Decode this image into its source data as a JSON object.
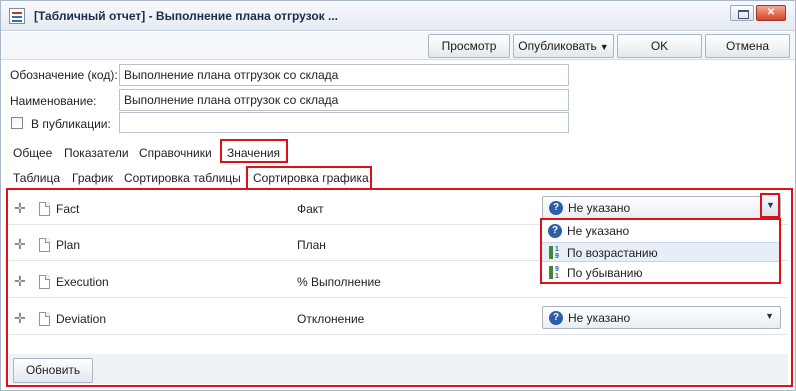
{
  "window": {
    "title": "[Табличный отчет] - Выполнение плана отгрузок ..."
  },
  "toolbar": {
    "preview_label": "Просмотр",
    "publish_label": "Опубликовать",
    "ok_label": "OK",
    "cancel_label": "Отмена"
  },
  "form": {
    "code_label": "Обозначение (код):",
    "code_value": "Выполнение плана отгрузок со склада",
    "name_label": "Наименование:",
    "name_value": "Выполнение плана отгрузок со склада",
    "publish_label": "В публикации:",
    "publish_value": ""
  },
  "tabs": [
    "Общее",
    "Показатели",
    "Справочники",
    "Значения"
  ],
  "subtabs": [
    "Таблица",
    "График",
    "Сортировка таблицы",
    "Сортировка графика"
  ],
  "rows": [
    {
      "name": "Fact",
      "caption": "Факт",
      "sort": "Не указано"
    },
    {
      "name": "Plan",
      "caption": "План",
      "sort": ""
    },
    {
      "name": "Execution",
      "caption": "% Выполнение",
      "sort": ""
    },
    {
      "name": "Deviation",
      "caption": "Отклонение",
      "sort": "Не указано"
    }
  ],
  "dropdown_options": [
    "Не указано",
    "По возрастанию",
    "По убыванию"
  ],
  "dropdown_selected_index": 1,
  "refresh_label": "Обновить",
  "colors": {
    "highlight_red": "#e0101a",
    "accent_blue": "#2d5fa8",
    "selection_bg": "#e8eef7"
  }
}
